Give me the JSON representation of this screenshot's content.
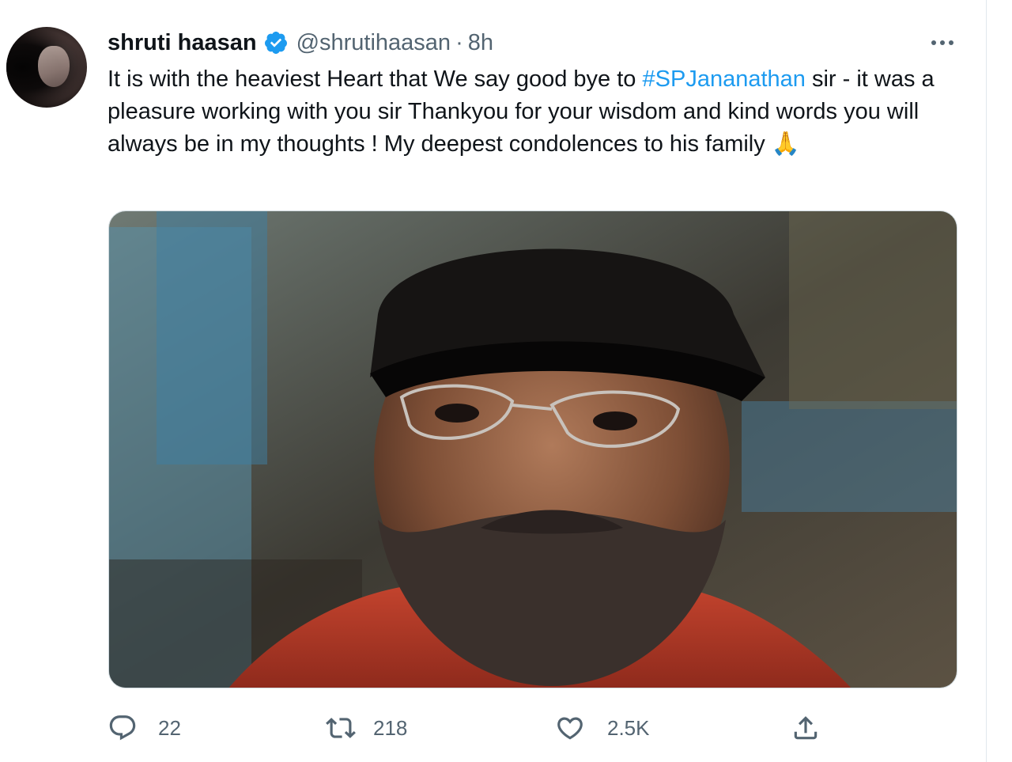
{
  "tweet": {
    "author": {
      "display_name": "shruti haasan",
      "handle": "@shrutihaasan",
      "verified": true
    },
    "separator": "·",
    "time": "8h",
    "text": {
      "before_hashtag": "It is with the heaviest Heart that We say good bye to ",
      "hashtag": "#SPJananathan",
      "after_hashtag": " sir - it was a pleasure working with you sir Thankyou for your wisdom and kind words you will always be in my thoughts ! My deepest condolences to his family ",
      "emoji": "🙏"
    },
    "media": {
      "icon": "photo-portrait"
    },
    "actions": {
      "reply_count": "22",
      "retweet_count": "218",
      "like_count": "2.5K"
    },
    "colors": {
      "accent": "#1d9bf0",
      "secondary_text": "#536471",
      "primary_text": "#0f1419"
    }
  }
}
